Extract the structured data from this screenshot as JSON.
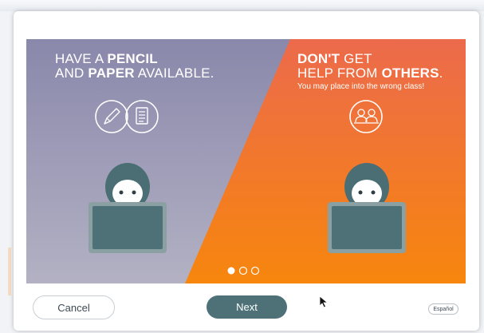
{
  "slide": {
    "left_line1_plain": "HAVE A ",
    "left_line1_bold": "PENCIL",
    "left_line2_plain_pre": "AND ",
    "left_line2_bold": "PAPER",
    "left_line2_plain_post": " AVAILABLE.",
    "right_line1_bold": "DON'T",
    "right_line1_plain": " GET",
    "right_line2_plain": "HELP FROM ",
    "right_line2_bold": "OTHERS",
    "right_line2_end": ".",
    "right_subtext": "You may place into the wrong class!",
    "carousel_pages": 3,
    "carousel_active": 0
  },
  "footer": {
    "cancel_label": "Cancel",
    "next_label": "Next",
    "language_label": "Español"
  },
  "colors": {
    "left_panel": "#8e8cae",
    "right_panel": "#f0733f",
    "next_button": "#4d7177",
    "laptop": "#4e7077"
  },
  "icons": [
    "pencil-icon",
    "document-icon",
    "group-icon",
    "mouse-pointer-icon"
  ]
}
